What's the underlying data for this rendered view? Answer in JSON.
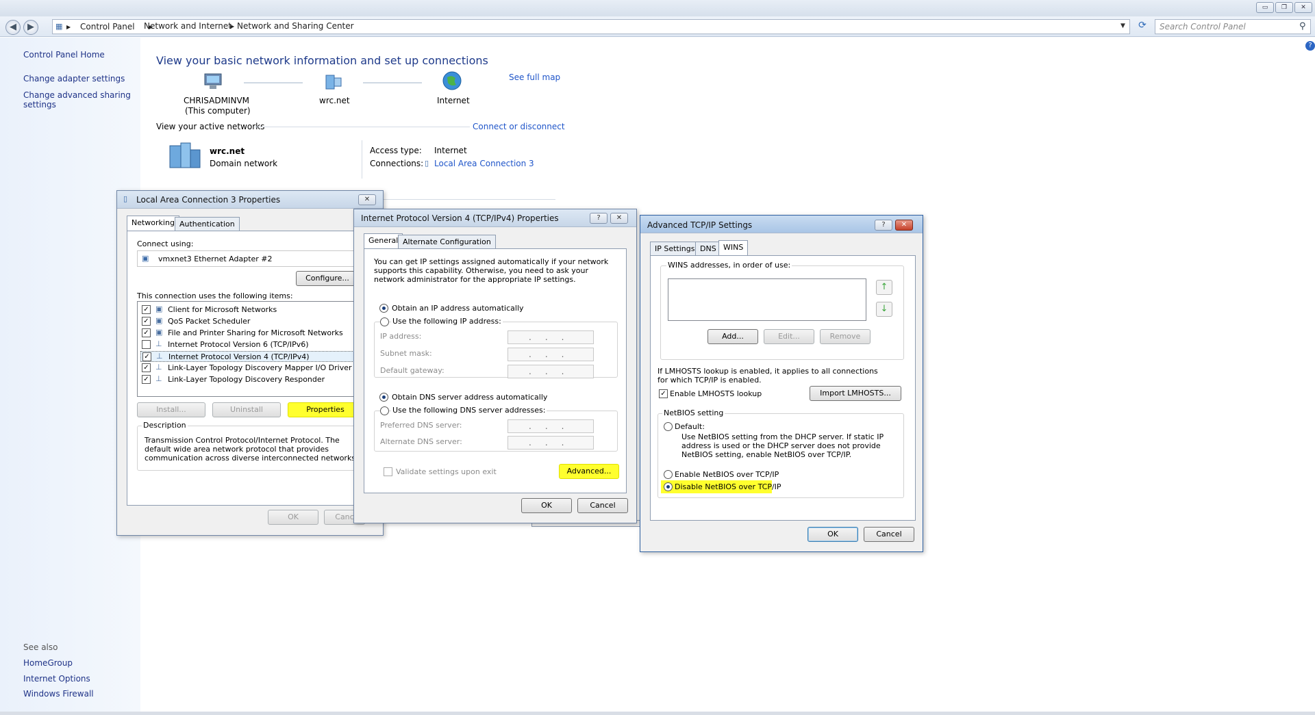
{
  "window": {
    "controls": [
      "▭",
      "❐",
      "✕"
    ]
  },
  "address": {
    "breadcrumbs": [
      "Control Panel",
      "Network and Internet",
      "Network and Sharing Center"
    ],
    "search_placeholder": "Search Control Panel"
  },
  "sidebar": {
    "home": "Control Panel Home",
    "links": [
      "Change adapter settings",
      "Change advanced sharing settings"
    ],
    "see_also_title": "See also",
    "see_also": [
      "HomeGroup",
      "Internet Options",
      "Windows Firewall"
    ]
  },
  "main": {
    "title": "View your basic network information and set up connections",
    "see_full_map": "See full map",
    "map": {
      "computer_name": "CHRISADMINVM",
      "computer_sub": "(This computer)",
      "network": "wrc.net",
      "internet": "Internet"
    },
    "active_networks_label": "View your active networks",
    "connect_disconnect": "Connect or disconnect",
    "network_name": "wrc.net",
    "network_type": "Domain network",
    "access_type_label": "Access type:",
    "access_type_value": "Internet",
    "connections_label": "Connections:",
    "connections_value": "Local Area Connection 3"
  },
  "lac_dialog": {
    "title": "Local Area Connection 3 Properties",
    "tabs": [
      "Networking",
      "Authentication"
    ],
    "connect_using_label": "Connect using:",
    "adapter": "vmxnet3 Ethernet Adapter #2",
    "configure": "Configure...",
    "items_label": "This connection uses the following items:",
    "items": [
      {
        "label": "Client for Microsoft Networks",
        "checked": true
      },
      {
        "label": "QoS Packet Scheduler",
        "checked": true
      },
      {
        "label": "File and Printer Sharing for Microsoft Networks",
        "checked": true
      },
      {
        "label": "Internet Protocol Version 6 (TCP/IPv6)",
        "checked": false
      },
      {
        "label": "Internet Protocol Version 4 (TCP/IPv4)",
        "checked": true
      },
      {
        "label": "Link-Layer Topology Discovery Mapper I/O Driver",
        "checked": true
      },
      {
        "label": "Link-Layer Topology Discovery Responder",
        "checked": true
      }
    ],
    "install": "Install...",
    "uninstall": "Uninstall",
    "properties": "Properties",
    "description_label": "Description",
    "description": "Transmission Control Protocol/Internet Protocol. The default wide area network protocol that provides communication across diverse interconnected networks.",
    "ok": "OK",
    "cancel": "Canc"
  },
  "ipv4_dialog": {
    "title": "Internet Protocol Version 4 (TCP/IPv4) Properties",
    "tabs": [
      "General",
      "Alternate Configuration"
    ],
    "intro": "You can get IP settings assigned automatically if your network supports this capability. Otherwise, you need to ask your network administrator for the appropriate IP settings.",
    "obtain_ip": "Obtain an IP address automatically",
    "use_ip": "Use the following IP address:",
    "ip_address": "IP address:",
    "subnet_mask": "Subnet mask:",
    "default_gateway": "Default gateway:",
    "obtain_dns": "Obtain DNS server address automatically",
    "use_dns": "Use the following DNS server addresses:",
    "preferred_dns": "Preferred DNS server:",
    "alternate_dns": "Alternate DNS server:",
    "ip_dots": "...",
    "validate": "Validate settings upon exit",
    "advanced": "Advanced...",
    "ok": "OK",
    "cancel": "Cancel"
  },
  "adv_dialog": {
    "title": "Advanced TCP/IP Settings",
    "tabs": [
      "IP Settings",
      "DNS",
      "WINS"
    ],
    "wins_label": "WINS addresses, in order of use:",
    "add": "Add...",
    "edit": "Edit...",
    "remove": "Remove",
    "lmhosts_note": "If LMHOSTS lookup is enabled, it applies to all connections for which TCP/IP is enabled.",
    "enable_lmhosts": "Enable LMHOSTS lookup",
    "import_lmhosts": "Import LMHOSTS...",
    "netbios_label": "NetBIOS setting",
    "default": "Default:",
    "default_desc": "Use NetBIOS setting from the DHCP server. If static IP address is used or the DHCP server does not provide NetBIOS setting, enable NetBIOS over TCP/IP.",
    "enable_netbios": "Enable NetBIOS over TCP/IP",
    "disable_netbios": "Disable NetBIOS over TCP/IP",
    "ok": "OK",
    "cancel": "Cancel"
  },
  "colors": {
    "highlight": "#ffff2e",
    "link": "#1f55c9",
    "title_blue": "#1e3a8a"
  }
}
